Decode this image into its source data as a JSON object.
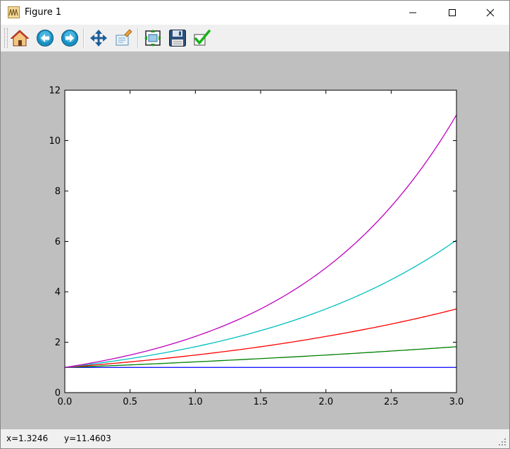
{
  "window": {
    "title": "Figure 1"
  },
  "toolbar": {
    "buttons": [
      {
        "name": "home",
        "icon": "home-icon"
      },
      {
        "name": "back",
        "icon": "back-arrow-icon"
      },
      {
        "name": "forward",
        "icon": "forward-arrow-icon"
      },
      {
        "name": "pan",
        "icon": "pan-move-icon"
      },
      {
        "name": "zoom",
        "icon": "zoom-rect-icon"
      },
      {
        "name": "subplots",
        "icon": "configure-subplots-icon"
      },
      {
        "name": "save",
        "icon": "save-floppy-icon"
      },
      {
        "name": "edit",
        "icon": "edit-checkmark-icon"
      }
    ]
  },
  "status": {
    "x_readout": "x=1.3246",
    "y_readout": "y=11.4603"
  },
  "chart_data": {
    "type": "line",
    "title": "",
    "xlabel": "",
    "ylabel": "",
    "xlim": [
      0,
      3
    ],
    "ylim": [
      0,
      12
    ],
    "grid": false,
    "xticks": [
      "0.0",
      "0.5",
      "1.0",
      "1.5",
      "2.0",
      "2.5",
      "3.0"
    ],
    "yticks": [
      "0",
      "2",
      "4",
      "6",
      "8",
      "10",
      "12"
    ],
    "xtick_values": [
      0,
      0.5,
      1,
      1.5,
      2,
      2.5,
      3
    ],
    "ytick_values": [
      0,
      2,
      4,
      6,
      8,
      10,
      12
    ],
    "series": [
      {
        "color": "#0000ff",
        "x": [
          0,
          0.5,
          1,
          1.5,
          2,
          2.5,
          3
        ],
        "y": [
          1.0,
          1.0,
          1.0,
          1.0,
          1.0,
          1.0,
          1.0
        ]
      },
      {
        "color": "#008000",
        "x": [
          0,
          0.5,
          1,
          1.5,
          2,
          2.5,
          3
        ],
        "y": [
          1.0,
          1.1,
          1.22,
          1.35,
          1.49,
          1.65,
          1.82
        ]
      },
      {
        "color": "#ff0000",
        "x": [
          0,
          0.5,
          1,
          1.5,
          2,
          2.5,
          3
        ],
        "y": [
          1.0,
          1.22,
          1.49,
          1.82,
          2.23,
          2.72,
          3.32
        ]
      },
      {
        "color": "#00bfbf",
        "x": [
          0,
          0.5,
          1,
          1.5,
          2,
          2.5,
          3
        ],
        "y": [
          1.0,
          1.35,
          1.82,
          2.46,
          3.32,
          4.48,
          6.05
        ]
      },
      {
        "color": "#bf00bf",
        "x": [
          0,
          0.5,
          1,
          1.5,
          2,
          2.5,
          3
        ],
        "y": [
          1.0,
          1.49,
          2.23,
          3.32,
          4.95,
          7.39,
          11.02
        ]
      }
    ]
  }
}
